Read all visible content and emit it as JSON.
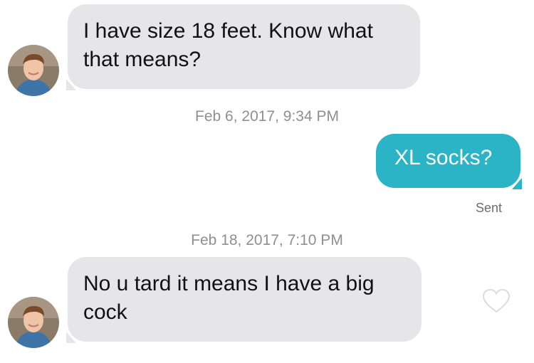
{
  "messages": [
    {
      "direction": "incoming",
      "text": "I have size 18 feet. Know what that means?"
    },
    {
      "direction": "outgoing",
      "text": "XL socks?",
      "status": "Sent"
    },
    {
      "direction": "incoming",
      "text": "No u tard it means I have a big cock"
    }
  ],
  "timestamps": [
    "Feb 6, 2017, 9:34 PM",
    "Feb 18, 2017, 7:10 PM"
  ],
  "icons": {
    "avatar": "avatar",
    "like": "heart-icon"
  },
  "colors": {
    "incoming_bubble": "#e6e6e8",
    "outgoing_bubble": "#2bb3c6",
    "timestamp_text": "#8e8e93"
  }
}
